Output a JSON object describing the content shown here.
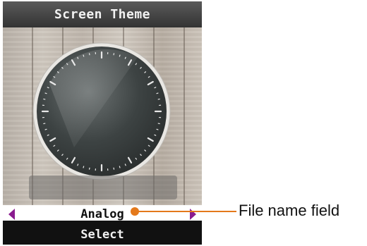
{
  "screen": {
    "title": "Screen Theme",
    "filename_value": "Analog",
    "softkey_label": "Select"
  },
  "annotation": {
    "label": "File name field"
  },
  "icons": {
    "left_arrow": "arrow-left-icon",
    "right_arrow": "arrow-right-icon",
    "clock": "analog-clock-icon"
  },
  "colors": {
    "accent_orange": "#e4791b",
    "arrow_purple": "#8a1b8f",
    "title_bar": "#444444"
  }
}
